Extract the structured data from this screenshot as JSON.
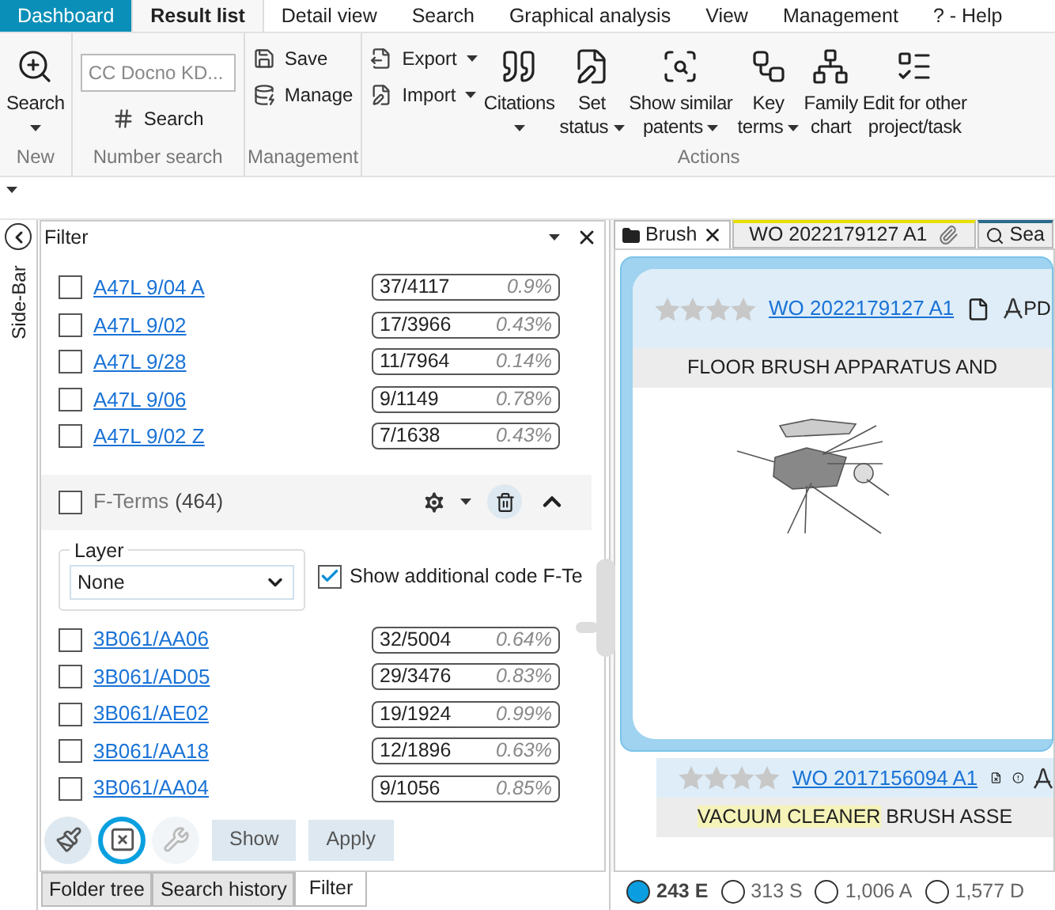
{
  "menu_tabs": [
    {
      "label": "Dashboard",
      "kind": "app",
      "selected": false
    },
    {
      "label": "Result list",
      "kind": "tab",
      "selected": true
    },
    {
      "label": "Detail view",
      "kind": "tab",
      "selected": false
    },
    {
      "label": "Search",
      "kind": "tab",
      "selected": false
    },
    {
      "label": "Graphical analysis",
      "kind": "tab",
      "selected": false
    },
    {
      "label": "View",
      "kind": "tab",
      "selected": false
    },
    {
      "label": "Management",
      "kind": "tab",
      "selected": false
    },
    {
      "label": "? - Help",
      "kind": "tab",
      "selected": false
    }
  ],
  "ribbon": {
    "groups": [
      {
        "label": "New",
        "items": [
          {
            "kind": "large",
            "lines": [
              "Search"
            ],
            "dropdown": true
          }
        ]
      },
      {
        "label": "Number search",
        "items": [
          {
            "kind": "field",
            "placeholder": "CC Docno KD..."
          },
          {
            "kind": "small",
            "lines": [
              "Search"
            ],
            "dropdown": false
          }
        ]
      },
      {
        "label": "Management",
        "items": [
          {
            "kind": "small",
            "lines": [
              "Save"
            ],
            "dropdown": false
          },
          {
            "kind": "small",
            "lines": [
              "Manage"
            ],
            "dropdown": false
          }
        ]
      },
      {
        "label": "Actions",
        "items": [
          {
            "kind": "small",
            "lines": [
              "Export"
            ],
            "dropdown": true
          },
          {
            "kind": "small",
            "lines": [
              "Import"
            ],
            "dropdown": true
          },
          {
            "kind": "large",
            "lines": [
              "Citations"
            ],
            "dropdown": true
          },
          {
            "kind": "large",
            "lines": [
              "Set",
              "status"
            ],
            "dropdown": true
          },
          {
            "kind": "large",
            "lines": [
              "Show similar",
              "patents"
            ],
            "dropdown": true
          },
          {
            "kind": "large",
            "lines": [
              "Key",
              "terms"
            ],
            "dropdown": true
          },
          {
            "kind": "large",
            "lines": [
              "Family",
              "chart"
            ],
            "dropdown": false
          },
          {
            "kind": "large",
            "lines": [
              "Edit for other",
              "project/task"
            ],
            "dropdown": false
          }
        ]
      }
    ]
  },
  "sidebar": {
    "label": "Side-Bar"
  },
  "filter": {
    "title": "Filter",
    "items": [
      {
        "code": "A47L 9/04 A",
        "count": "37/4117",
        "percent": "0.9%",
        "checked": false
      },
      {
        "code": "A47L 9/02",
        "count": "17/3966",
        "percent": "0.43%",
        "checked": false
      },
      {
        "code": "A47L 9/28",
        "count": "11/7964",
        "percent": "0.14%",
        "checked": false
      },
      {
        "code": "A47L 9/06",
        "count": "9/1149",
        "percent": "0.78%",
        "checked": false
      },
      {
        "code": "A47L 9/02 Z",
        "count": "7/1638",
        "percent": "0.43%",
        "checked": false
      }
    ],
    "section": {
      "label": "F-Terms",
      "count": "(464)",
      "checked": false,
      "expanded": true,
      "layer": {
        "label": "Layer",
        "value": "None"
      },
      "option": {
        "label": "Show additional code F-Te",
        "checked": true
      },
      "items": [
        {
          "code": "3B061/AA06",
          "count": "32/5004",
          "percent": "0.64%",
          "checked": false
        },
        {
          "code": "3B061/AD05",
          "count": "29/3476",
          "percent": "0.83%",
          "checked": false
        },
        {
          "code": "3B061/AE02",
          "count": "19/1924",
          "percent": "0.99%",
          "checked": false
        },
        {
          "code": "3B061/AA18",
          "count": "12/1896",
          "percent": "0.63%",
          "checked": false
        },
        {
          "code": "3B061/AA04",
          "count": "9/1056",
          "percent": "0.85%",
          "checked": false
        }
      ]
    },
    "tools": [
      {
        "highlighted": false,
        "disabled": false
      },
      {
        "highlighted": true,
        "disabled": false
      },
      {
        "highlighted": false,
        "disabled": true
      }
    ],
    "buttons": [
      "Show",
      "Apply"
    ]
  },
  "bottom_tabs": [
    {
      "label": "Folder tree",
      "selected": false
    },
    {
      "label": "Search history",
      "selected": false
    },
    {
      "label": "Filter",
      "selected": true
    }
  ],
  "doc_tabs": [
    {
      "label": "Brush",
      "selected": true
    },
    {
      "label": "WO 2022179127 A1",
      "selected": false
    },
    {
      "label": "Sea",
      "selected": false
    }
  ],
  "results": [
    {
      "stars": 0,
      "number": "WO 2022179127 A1",
      "pdf": "PD",
      "title": [
        {
          "text": "FLOOR BRUSH APPARATUS AND",
          "highlighted": false
        }
      ],
      "selected": true
    },
    {
      "stars": 0,
      "number": "WO 2017156094 A1",
      "title": [
        {
          "text": "VACUUM CLEANER",
          "highlighted": true
        },
        {
          "text": " BRUSH ASSE",
          "highlighted": false
        }
      ],
      "selected": false
    }
  ],
  "counts": [
    {
      "label": "243 E",
      "selected": true
    },
    {
      "label": "313 S",
      "selected": false
    },
    {
      "label": "1,006 A",
      "selected": false
    },
    {
      "label": "1,577 D",
      "selected": false
    }
  ]
}
